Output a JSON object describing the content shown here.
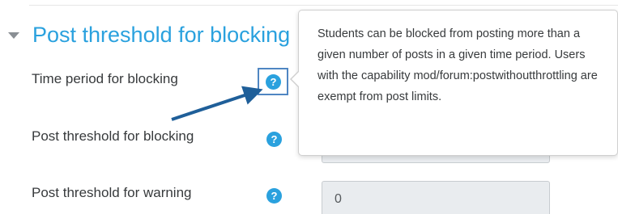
{
  "section": {
    "title": "Post threshold for blocking",
    "expanded": true
  },
  "fields": [
    {
      "label": "Time period for blocking",
      "help_icon": "question-circle-icon"
    },
    {
      "label": "Post threshold for blocking",
      "help_icon": "question-circle-icon",
      "value": ""
    },
    {
      "label": "Post threshold for warning",
      "help_icon": "question-circle-icon",
      "value": "0"
    }
  ],
  "help_glyph": "?",
  "popover": {
    "text": "Students can be blocked from posting more than a given number of posts in a given time period. Users with the capability mod/forum:postwithoutthrottling are exempt from post limits."
  },
  "colors": {
    "accent": "#2aa1de",
    "annotation_arrow": "#1f5f99",
    "input_bg": "#e9ecef"
  }
}
